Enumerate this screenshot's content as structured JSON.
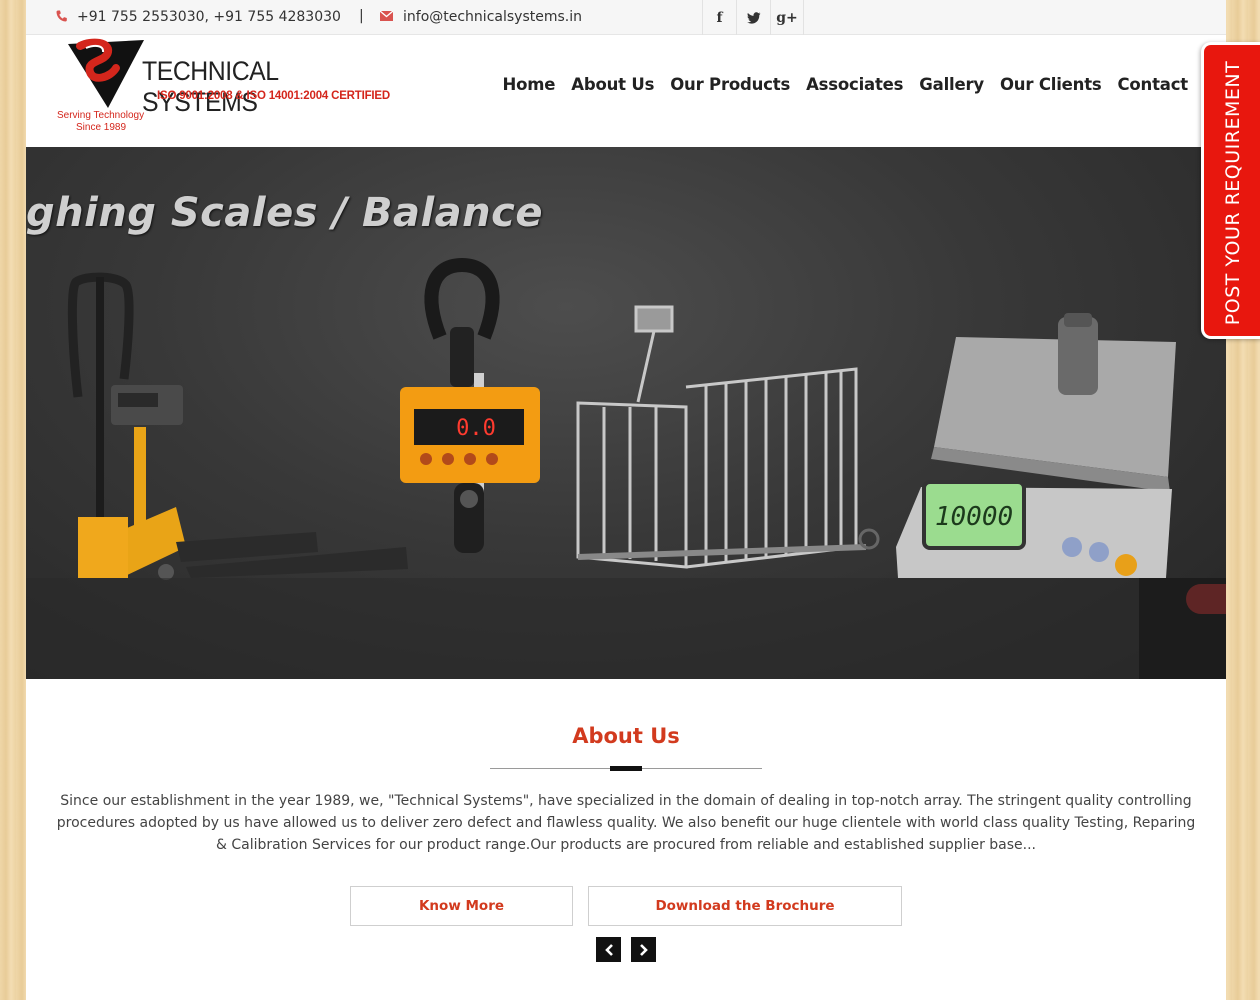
{
  "topbar": {
    "phone_icon": "phone-icon",
    "phone": "+91 755 2553030, +91 755 4283030",
    "separator": "|",
    "email_icon": "envelope-icon",
    "email": "info@technicalsystems.in",
    "social": [
      {
        "icon": "facebook-icon",
        "glyph": "f"
      },
      {
        "icon": "twitter-icon",
        "glyph": "t"
      },
      {
        "icon": "google-plus-icon",
        "glyph": "g+"
      }
    ]
  },
  "logo": {
    "brand": "TECHNICAL SYSTEMS",
    "certification": "ISO 9001:2008 & ISO 14001:2004 CERTIFIED",
    "tagline_1": "Serving Technology",
    "tagline_2": "Since 1989",
    "colors": {
      "red": "#d4261c",
      "black": "#111111"
    }
  },
  "nav": {
    "items": [
      "Home",
      "About Us",
      "Our Products",
      "Associates",
      "Gallery",
      "Our Clients",
      "Contact"
    ]
  },
  "hero": {
    "title": "ghing Scales / Balance",
    "display_crane": "0.0",
    "display_table": "10000"
  },
  "about": {
    "title": "About Us",
    "text": "Since our establishment in the year 1989, we, \"Technical Systems\", have specialized in the domain of dealing in top-notch array. The stringent quality controlling procedures adopted by us have allowed us to deliver zero defect and flawless quality. We also benefit our huge clientele with world class quality Testing, Reparing & Calibration Services for our product range.Our products are procured from reliable and established supplier base...",
    "know_more": "Know More",
    "brochure": "Download the Brochure",
    "prev_icon": "chevron-left-icon",
    "next_icon": "chevron-right-icon",
    "accent_color": "#d23a1e"
  },
  "side_tab": {
    "label": "POST YOUR REQUIREMENT",
    "color": "#e8170e"
  }
}
